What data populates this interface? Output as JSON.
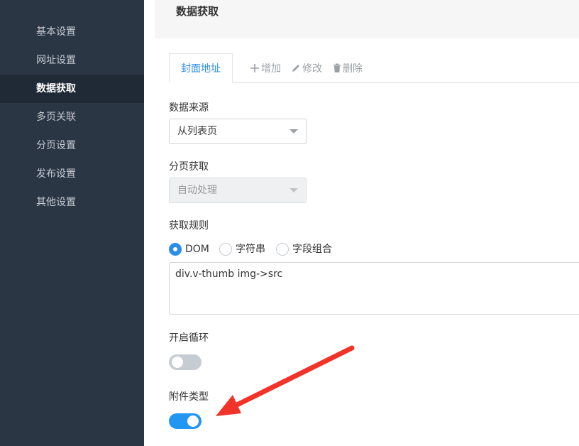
{
  "sidebar": {
    "items": [
      {
        "label": "基本设置"
      },
      {
        "label": "网址设置"
      },
      {
        "label": "数据获取",
        "active": true
      },
      {
        "label": "多页关联"
      },
      {
        "label": "分页设置"
      },
      {
        "label": "发布设置"
      },
      {
        "label": "其他设置"
      }
    ]
  },
  "header": {
    "title": "数据获取"
  },
  "tabs": {
    "active_label": "封面地址",
    "add_label": "增加",
    "edit_label": "修改",
    "delete_label": "删除",
    "add_icon": "plus-icon",
    "edit_icon": "pencil-icon",
    "delete_icon": "trash-icon"
  },
  "form": {
    "source": {
      "label": "数据来源",
      "value": "从列表页"
    },
    "pagination": {
      "label": "分页获取",
      "value": "自动处理",
      "disabled": true
    },
    "rule": {
      "label": "获取规则",
      "options": [
        "DOM",
        "字符串",
        "字段组合"
      ],
      "selected": "DOM",
      "value": "div.v-thumb img->src"
    },
    "loop": {
      "label": "开启循环",
      "enabled": false
    },
    "attachment": {
      "label": "附件类型",
      "enabled": true
    }
  },
  "colors": {
    "sidebar_bg": "#2b3645",
    "accent": "#2196f3",
    "annotation_arrow": "#f2332a"
  }
}
